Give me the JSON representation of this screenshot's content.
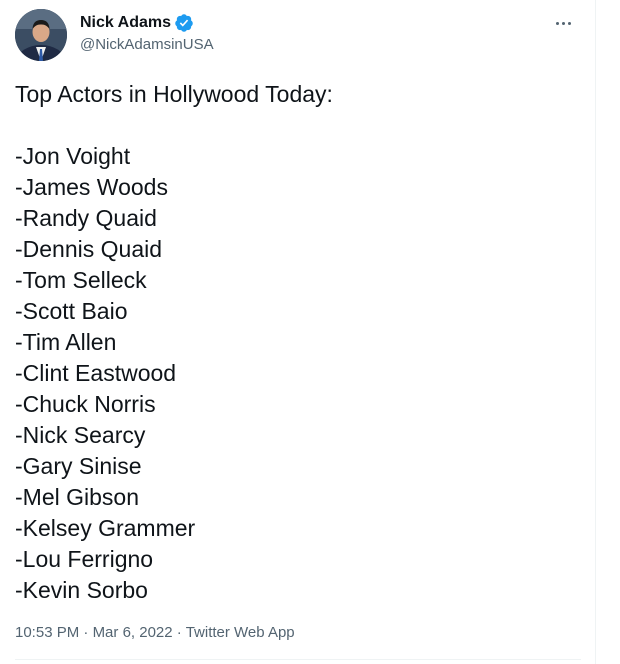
{
  "user": {
    "display_name": "Nick Adams",
    "handle": "@NickAdamsinUSA",
    "verified": true
  },
  "tweet": {
    "heading": "Top Actors in Hollywood Today:",
    "items": [
      "-Jon Voight",
      "-James Woods",
      "-Randy Quaid",
      "-Dennis Quaid",
      "-Tom Selleck",
      "-Scott Baio",
      "-Tim Allen",
      "-Clint Eastwood",
      "-Chuck Norris",
      "-Nick Searcy",
      "-Gary Sinise",
      "-Mel Gibson",
      "-Kelsey Grammer",
      "-Lou Ferrigno",
      "-Kevin Sorbo"
    ],
    "time": "10:53 PM",
    "separator": "·",
    "date": "Mar 6, 2022",
    "source": "Twitter Web App"
  },
  "colors": {
    "text": "#0f1419",
    "secondary": "#536471",
    "verified": "#1d9bf0",
    "divider": "#eff3f4"
  },
  "icons": {
    "avatar": "profile-photo",
    "verified": "verified-badge-icon",
    "more": "more-options-icon"
  }
}
